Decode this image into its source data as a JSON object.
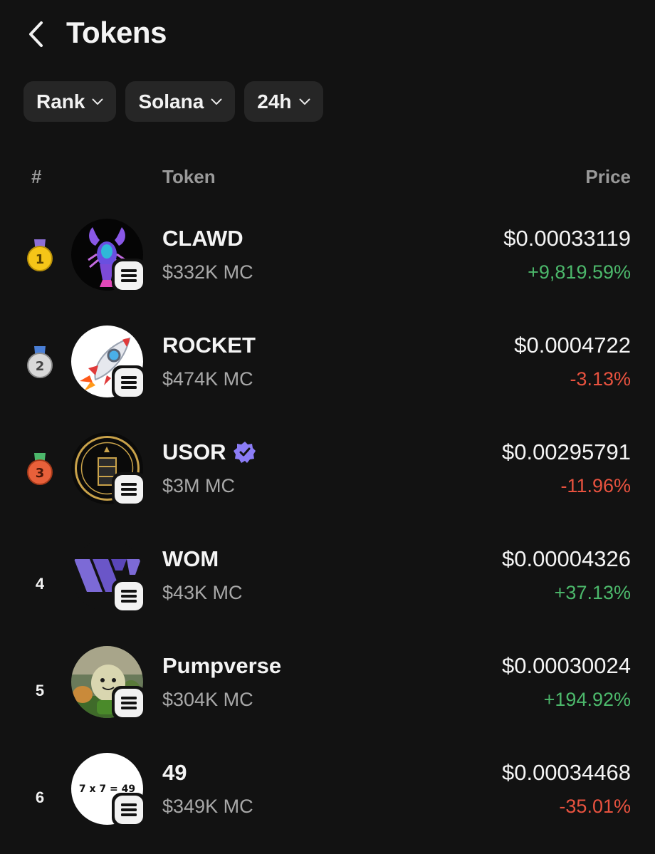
{
  "header": {
    "title": "Tokens"
  },
  "filters": [
    {
      "label": "Rank"
    },
    {
      "label": "Solana"
    },
    {
      "label": "24h"
    }
  ],
  "columns": {
    "rank": "#",
    "token": "Token",
    "price": "Price"
  },
  "tokens": [
    {
      "rank": "1",
      "name": "CLAWD",
      "market_cap": "$332K MC",
      "price": "$0.00033119",
      "change": "+9,819.59%"
    },
    {
      "rank": "2",
      "name": "ROCKET",
      "market_cap": "$474K MC",
      "price": "$0.0004722",
      "change": "-3.13%"
    },
    {
      "rank": "3",
      "name": "USOR",
      "market_cap": "$3M MC",
      "price": "$0.00295791",
      "change": "-11.96%"
    },
    {
      "rank": "4",
      "name": "WOM",
      "market_cap": "$43K MC",
      "price": "$0.00004326",
      "change": "+37.13%"
    },
    {
      "rank": "5",
      "name": "Pumpverse",
      "market_cap": "$304K MC",
      "price": "$0.00030024",
      "change": "+194.92%"
    },
    {
      "rank": "6",
      "name": "49",
      "market_cap": "$349K MC",
      "price": "$0.00034468",
      "change": "-35.01%",
      "avatar_text": "7 x 7 = 49"
    }
  ],
  "colors": {
    "background": "#121212",
    "positive": "#4cb86b",
    "negative": "#e8523f",
    "verified": "#8b7cf6"
  }
}
